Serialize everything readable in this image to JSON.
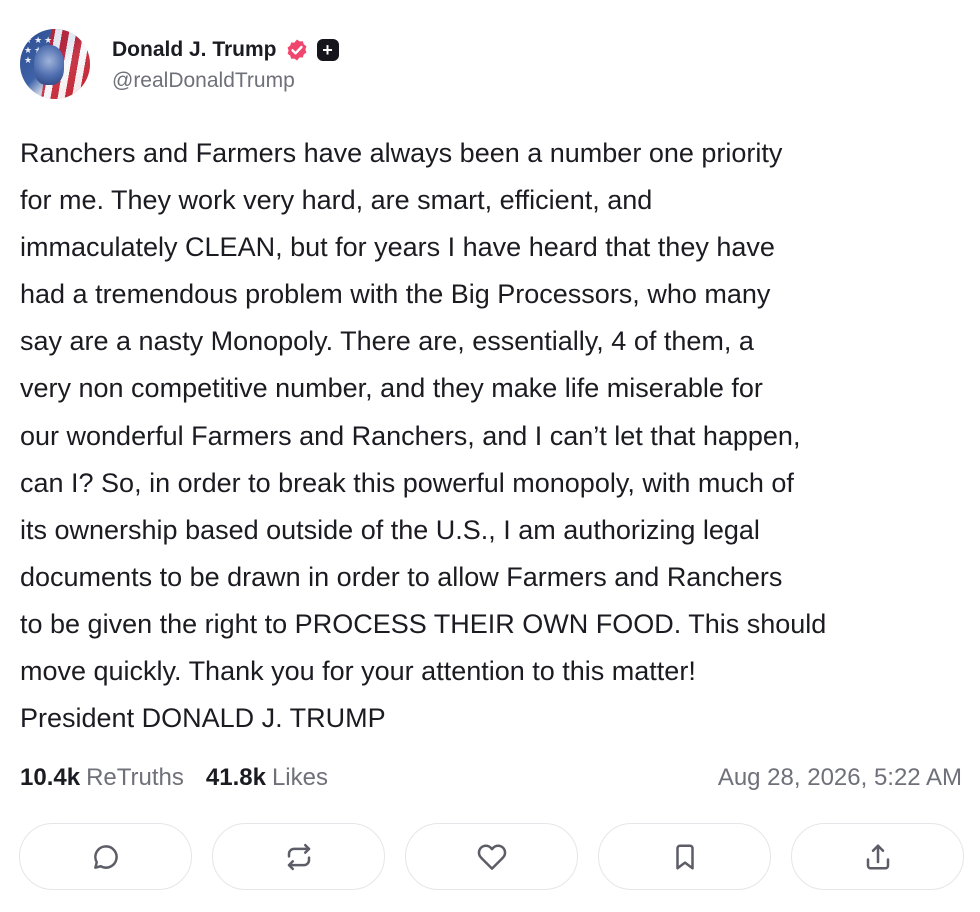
{
  "author": {
    "display_name": "Donald J. Trump",
    "handle": "@realDonaldTrump",
    "verified_badge_icon": "verified-badge-icon",
    "verified_badge_color": "#f0466e",
    "plus_badge_label": "+"
  },
  "post": {
    "text": "Ranchers and Farmers have always been a number one priority\nfor me. They work very hard, are smart, efficient, and\nimmaculately CLEAN, but for years I have heard that they have\nhad a tremendous problem with the Big Processors, who many\nsay are a nasty Monopoly. There are, essentially, 4 of them, a\nvery non competitive number, and they make life miserable for\nour wonderful Farmers and Ranchers, and I can’t let that happen,\ncan I? So, in order to break this powerful monopoly, with much of\nits ownership based outside of the U.S., I am authorizing legal\ndocuments to be drawn in order to allow Farmers and Ranchers\nto be given the right to PROCESS THEIR OWN FOOD. This should\nmove quickly. Thank you for your attention to this matter!\nPresident DONALD J. TRUMP"
  },
  "stats": {
    "retruths_count": "10.4k",
    "retruths_label": "ReTruths",
    "likes_count": "41.8k",
    "likes_label": "Likes",
    "timestamp": "Aug 28, 2026, 5:22 AM"
  },
  "actions": [
    {
      "icon": "reply-icon"
    },
    {
      "icon": "retruth-icon"
    },
    {
      "icon": "like-icon"
    },
    {
      "icon": "bookmark-icon"
    },
    {
      "icon": "share-icon"
    }
  ],
  "colors": {
    "text_primary": "#1b1b22",
    "text_secondary": "#6f7079",
    "border": "#e6e6ea",
    "icon": "#5c5d66"
  }
}
